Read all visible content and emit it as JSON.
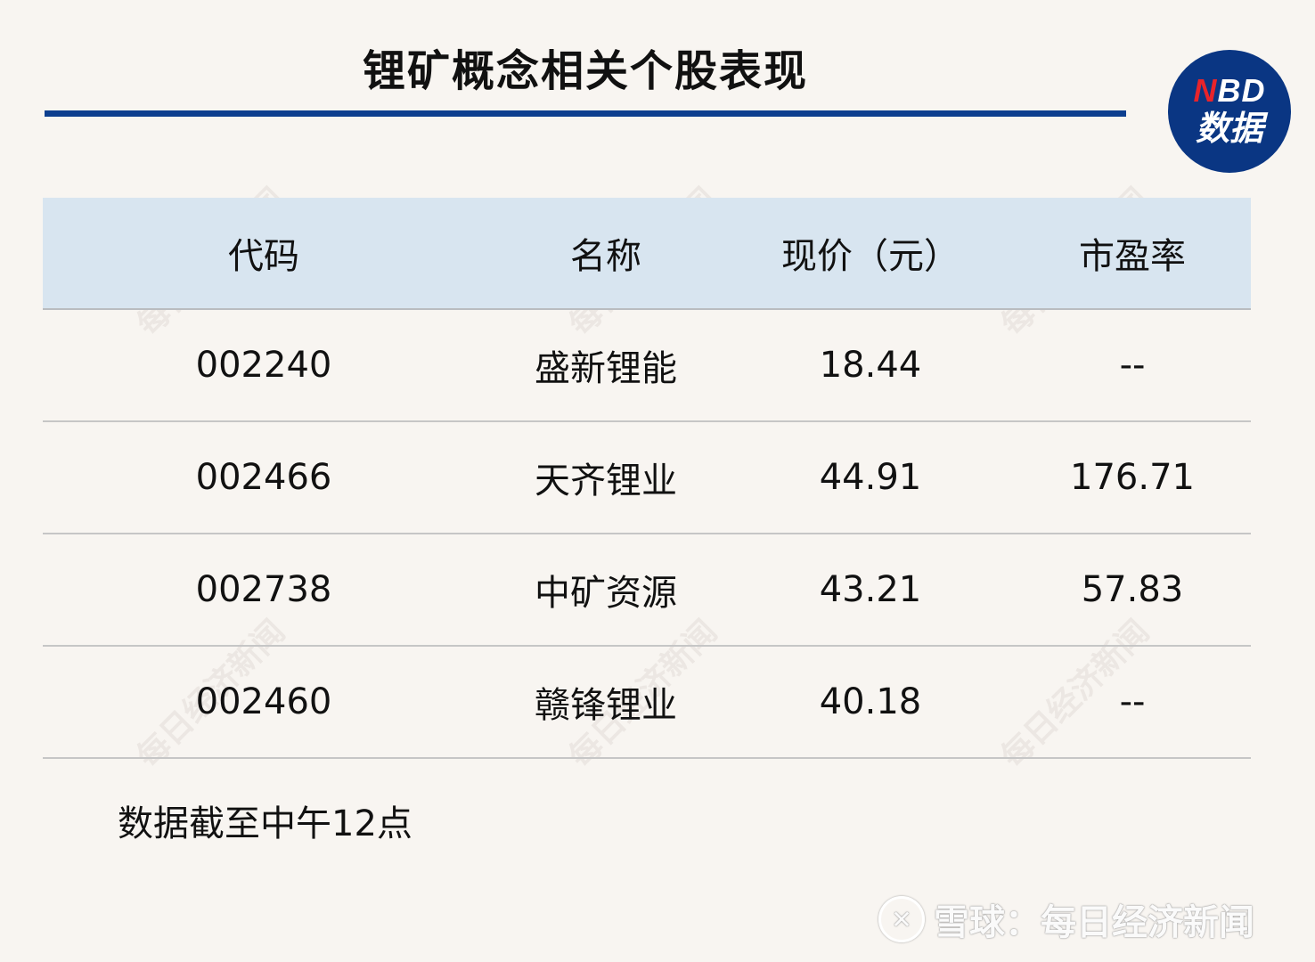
{
  "title": "锂矿概念相关个股表现",
  "logo": {
    "line1_n": "N",
    "line1_rest": "BD",
    "line2": "数据"
  },
  "watermark_text": "每日经济新闻",
  "table": {
    "headers": [
      "代码",
      "名称",
      "现价（元）",
      "市盈率"
    ],
    "rows": [
      [
        "002240",
        "盛新锂能",
        "18.44",
        "--"
      ],
      [
        "002466",
        "天齐锂业",
        "44.91",
        "176.71"
      ],
      [
        "002738",
        "中矿资源",
        "43.21",
        "57.83"
      ],
      [
        "002460",
        "赣锋锂业",
        "40.18",
        "--"
      ]
    ]
  },
  "note": "数据截至中午12点",
  "footer": {
    "icon": "snowball-icon",
    "text": "雪球：每日经济新闻"
  },
  "colors": {
    "accent": "#0d3f8f",
    "header_bg": "#d8e5f0",
    "logo_red": "#e8242b",
    "background": "#f8f5f1"
  }
}
